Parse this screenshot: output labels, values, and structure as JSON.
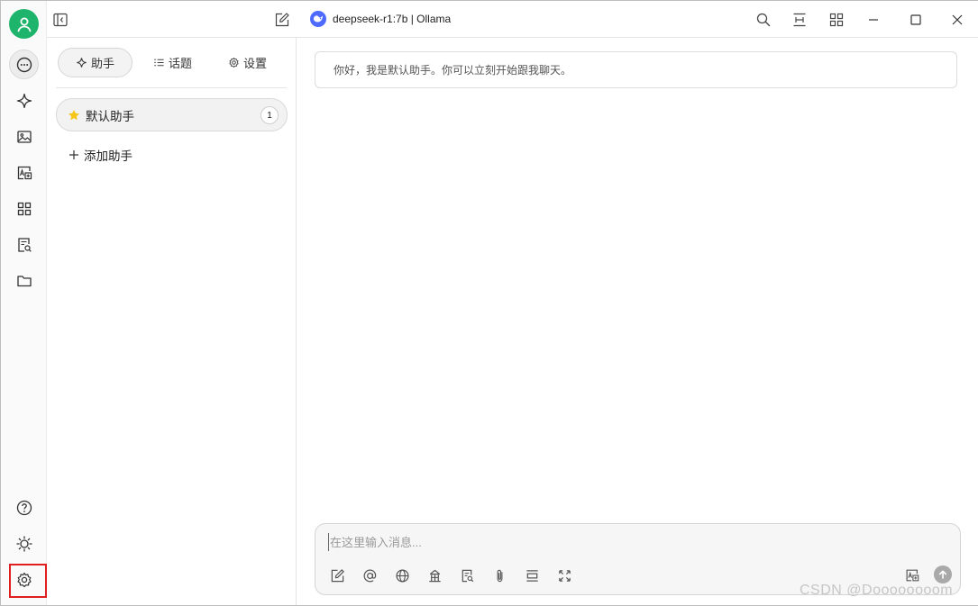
{
  "titlebar": {
    "model_title": "deepseek-r1:7b | Ollama"
  },
  "rail": {
    "items": [
      {
        "icon": "chat-icon"
      },
      {
        "icon": "sparkle-icon"
      },
      {
        "icon": "image-icon"
      },
      {
        "icon": "translate-icon"
      },
      {
        "icon": "apps-icon"
      },
      {
        "icon": "knowledge-icon"
      },
      {
        "icon": "folder-icon"
      }
    ],
    "bottom": [
      {
        "icon": "help-icon"
      },
      {
        "icon": "theme-icon"
      },
      {
        "icon": "gear-icon"
      }
    ]
  },
  "panel": {
    "tabs": [
      {
        "label": "助手",
        "icon": "sparkle-icon"
      },
      {
        "label": "话题",
        "icon": "list-icon"
      },
      {
        "label": "设置",
        "icon": "gear-icon"
      }
    ],
    "assistant": {
      "name": "默认助手",
      "count": "1"
    },
    "add_label": "添加助手"
  },
  "chat": {
    "welcome": "你好，我是默认助手。你可以立刻开始跟我聊天。",
    "placeholder": "在这里输入消息..."
  },
  "watermark": "CSDN @Doooooooom",
  "colors": {
    "avatar": "#1fb46b",
    "model_logo": "#4d6bfe",
    "highlight_box": "#e02020",
    "star": "#f5c518"
  }
}
